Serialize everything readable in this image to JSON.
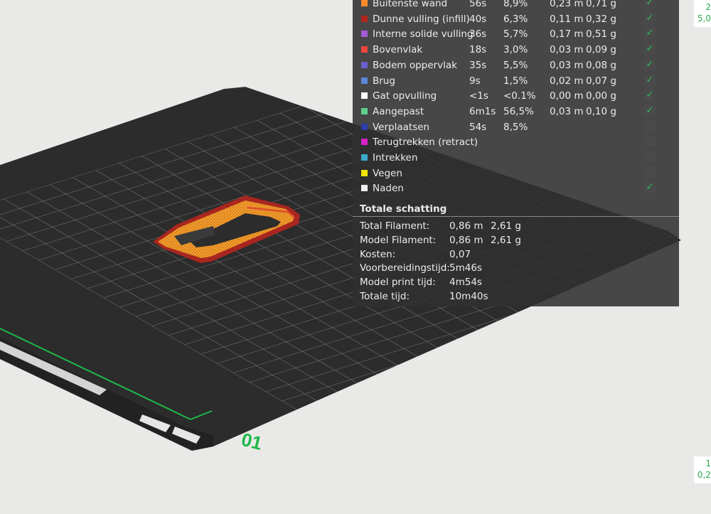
{
  "legend": {
    "rows": [
      {
        "color": "#ff8c2e",
        "name": "Buitenste wand",
        "time": "56s",
        "pct": "8,9%",
        "len": "0,23 m",
        "wt": "0,71 g",
        "checked": true
      },
      {
        "color": "#b3261e",
        "name": "Dunne vulling (infill)",
        "time": "40s",
        "pct": "6,3%",
        "len": "0,11 m",
        "wt": "0,32 g",
        "checked": true
      },
      {
        "color": "#a35bd6",
        "name": "Interne solide vulling",
        "time": "36s",
        "pct": "5,7%",
        "len": "0,17 m",
        "wt": "0,51 g",
        "checked": true
      },
      {
        "color": "#f0473d",
        "name": "Bovenvlak",
        "time": "18s",
        "pct": "3,0%",
        "len": "0,03 m",
        "wt": "0,09 g",
        "checked": true
      },
      {
        "color": "#6b5fd1",
        "name": "Bodem oppervlak",
        "time": "35s",
        "pct": "5,5%",
        "len": "0,03 m",
        "wt": "0,08 g",
        "checked": true
      },
      {
        "color": "#5b86d9",
        "name": "Brug",
        "time": "9s",
        "pct": "1,5%",
        "len": "0,02 m",
        "wt": "0,07 g",
        "checked": true
      },
      {
        "color": "#ffffff",
        "name": "Gat opvulling",
        "time": "<1s",
        "pct": "<0.1%",
        "len": "0,00 m",
        "wt": "0,00 g",
        "checked": true
      },
      {
        "color": "#5fcf8e",
        "name": "Aangepast",
        "time": "6m1s",
        "pct": "56,5%",
        "len": "0,03 m",
        "wt": "0,10 g",
        "checked": true
      },
      {
        "color": "#2b3ea8",
        "name": "Verplaatsen",
        "time": "54s",
        "pct": "8,5%",
        "len": "",
        "wt": "",
        "checked": false
      },
      {
        "color": "#d621c9",
        "name": "Terugtrekken (retract)",
        "time": "",
        "pct": "",
        "len": "",
        "wt": "",
        "checked": false
      },
      {
        "color": "#3ba9c8",
        "name": "Intrekken",
        "time": "",
        "pct": "",
        "len": "",
        "wt": "",
        "checked": false
      },
      {
        "color": "#f2e600",
        "name": "Vegen",
        "time": "",
        "pct": "",
        "len": "",
        "wt": "",
        "checked": false
      },
      {
        "color": "#eeeeee",
        "name": "Naden",
        "time": "",
        "pct": "",
        "len": "",
        "wt": "",
        "checked": true
      }
    ]
  },
  "totals": {
    "title": "Totale schatting",
    "rows": [
      {
        "label": "Total Filament:",
        "v1": "0,86 m",
        "v2": "2,61 g"
      },
      {
        "label": "Model Filament:",
        "v1": "0,86 m",
        "v2": "2,61 g"
      },
      {
        "label": "Kosten:",
        "v1": "0,07",
        "v2": ""
      },
      {
        "label": "Voorbereidingstijd:",
        "v1": "5m46s",
        "v2": ""
      },
      {
        "label": "Model print tijd:",
        "v1": "4m54s",
        "v2": ""
      },
      {
        "label": "Totale tijd:",
        "v1": "10m40s",
        "v2": ""
      }
    ]
  },
  "bed": {
    "plate_number": "01"
  },
  "side_labels": {
    "top": [
      "2",
      "5,0"
    ],
    "bottom": [
      "1",
      "0,2"
    ]
  },
  "colors": {
    "check": "#2fc25b",
    "plate_number": "#1fb84a",
    "model_outer": "#c8302a",
    "model_infill": "#e58a1a"
  }
}
